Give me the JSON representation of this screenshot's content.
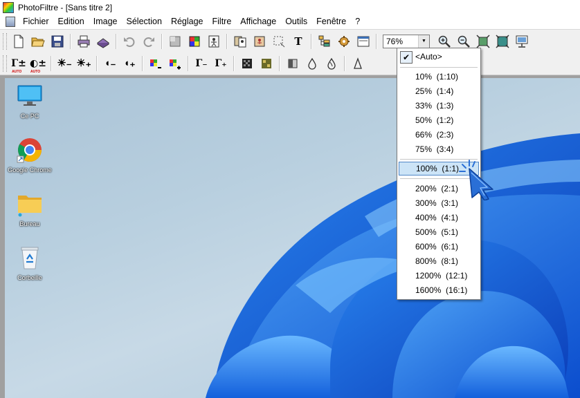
{
  "window": {
    "title": "PhotoFiltre - [Sans titre 2]"
  },
  "menu": [
    "Fichier",
    "Edition",
    "Image",
    "Sélection",
    "Réglage",
    "Filtre",
    "Affichage",
    "Outils",
    "Fenêtre",
    "?"
  ],
  "toolbar": {
    "zoom_value": "76%",
    "icons_row1": [
      "new-icon",
      "open-icon",
      "save-icon",
      "print-icon",
      "scan-icon",
      "undo-icon",
      "redo-icon",
      "fill-icon",
      "color-picker-icon",
      "transform-icon",
      "stamp-icon",
      "selection-icon",
      "text-icon",
      "browser-icon",
      "plugin-icon",
      "window-icon"
    ],
    "icons_row2": [
      "gamma-auto-minus",
      "gamma-auto-plus",
      "brightness-minus",
      "brightness-plus",
      "contrast-minus",
      "contrast-plus",
      "saturation-minus",
      "saturation-plus",
      "gamma-minus",
      "gamma-plus"
    ],
    "text_tool": "T",
    "gamma_label": "Γ",
    "auto_label": "AUTO"
  },
  "zoom_menu": {
    "auto": "<Auto>",
    "items": [
      {
        "label": "10%  (1:10)"
      },
      {
        "label": "25%  (1:4)"
      },
      {
        "label": "33%  (1:3)"
      },
      {
        "label": "50%  (1:2)"
      },
      {
        "label": "66%  (2:3)"
      },
      {
        "label": "75%  (3:4)"
      },
      {
        "label": "100%  (1:1)"
      },
      {
        "label": "200%  (2:1)"
      },
      {
        "label": "300%  (3:1)"
      },
      {
        "label": "400%  (4:1)"
      },
      {
        "label": "500%  (5:1)"
      },
      {
        "label": "600%  (6:1)"
      },
      {
        "label": "800%  (8:1)"
      },
      {
        "label": "1200%  (12:1)"
      },
      {
        "label": "1600%  (16:1)"
      }
    ],
    "highlighted": "100%  (1:1)"
  },
  "desktop_icons": [
    {
      "label": "Ce PC",
      "icon": "monitor-icon"
    },
    {
      "label": "Google Chrome",
      "icon": "chrome-icon"
    },
    {
      "label": "Bureau",
      "icon": "folder-icon"
    },
    {
      "label": "Corbeille",
      "icon": "recycle-bin-icon"
    }
  ]
}
